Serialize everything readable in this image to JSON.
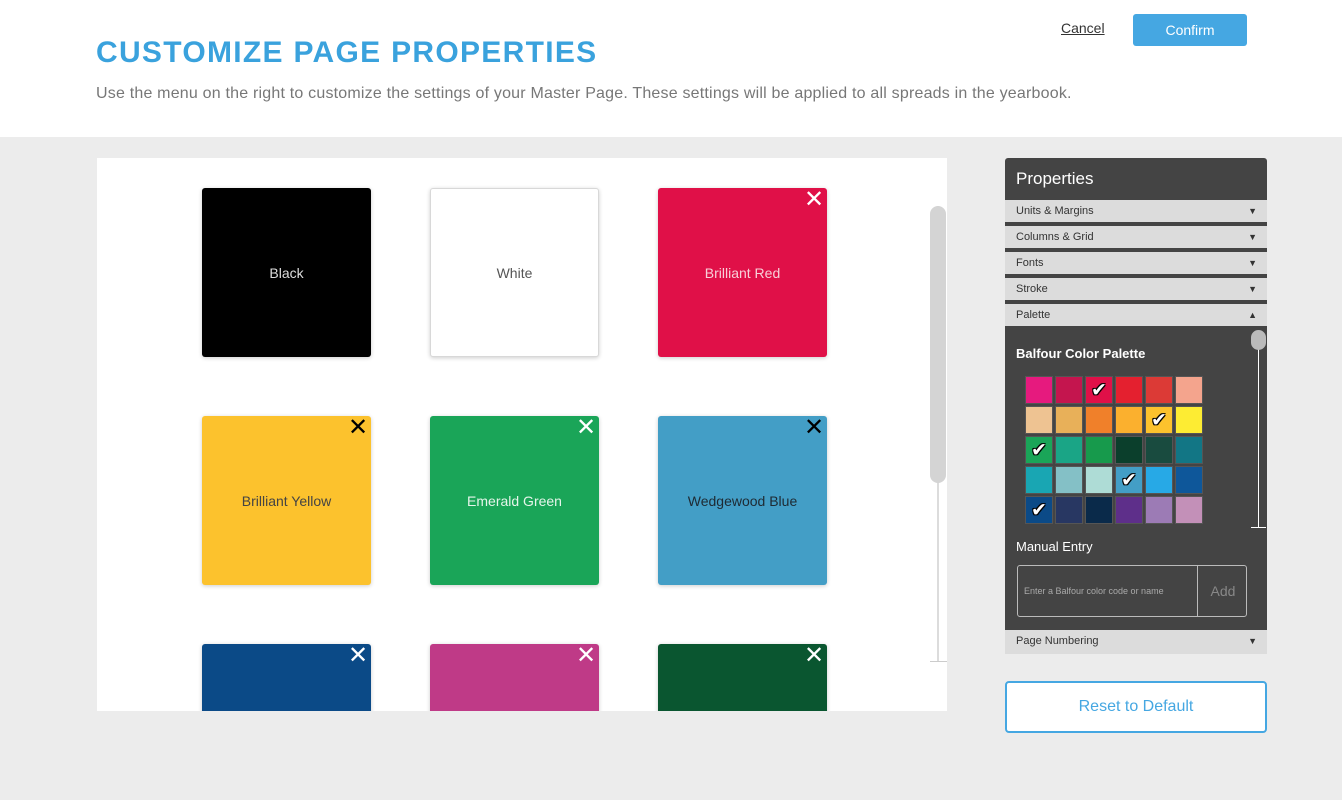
{
  "header": {
    "title": "CUSTOMIZE PAGE PROPERTIES",
    "subtitle": "Use the menu on the right to customize the settings of your Master Page. These settings will be applied to all spreads in the yearbook.",
    "cancel_label": "Cancel",
    "confirm_label": "Confirm"
  },
  "swatches": [
    {
      "label": "Black",
      "color": "#000000",
      "text_color": "#dddddd",
      "removable": false
    },
    {
      "label": "White",
      "color": "#ffffff",
      "text_color": "#555555",
      "removable": false
    },
    {
      "label": "Brilliant Red",
      "color": "#e01048",
      "text_color": "#f7d0d8",
      "removable": true,
      "x_color": "#ffffff"
    },
    {
      "label": "Brilliant Yellow",
      "color": "#fcc22d",
      "text_color": "#444444",
      "removable": true,
      "x_color": "#000000"
    },
    {
      "label": "Emerald Green",
      "color": "#1aa558",
      "text_color": "#e6f5ea",
      "removable": true,
      "x_color": "#ffffff"
    },
    {
      "label": "Wedgewood Blue",
      "color": "#439ec6",
      "text_color": "#1e2a33",
      "removable": true,
      "x_color": "#000000"
    },
    {
      "label": "",
      "color": "#0b4a87",
      "text_color": "#ffffff",
      "removable": true,
      "x_color": "#ffffff"
    },
    {
      "label": "",
      "color": "#bf3a87",
      "text_color": "#ffffff",
      "removable": true,
      "x_color": "#ffffff"
    },
    {
      "label": "",
      "color": "#0a5630",
      "text_color": "#ffffff",
      "removable": true,
      "x_color": "#ffffff"
    }
  ],
  "properties": {
    "title": "Properties",
    "sections": [
      {
        "label": "Units & Margins",
        "arrow": "▼"
      },
      {
        "label": "Columns & Grid",
        "arrow": "▼"
      },
      {
        "label": "Fonts",
        "arrow": "▼"
      },
      {
        "label": "Stroke",
        "arrow": "▼"
      },
      {
        "label": "Palette",
        "arrow": "▲"
      }
    ],
    "palette": {
      "heading": "Balfour Color Palette",
      "colors": [
        {
          "color": "#e61a7e",
          "checked": false
        },
        {
          "color": "#c4154e",
          "checked": false
        },
        {
          "color": "#e01048",
          "checked": true
        },
        {
          "color": "#e4202f",
          "checked": false
        },
        {
          "color": "#dc3a36",
          "checked": false
        },
        {
          "color": "#f4a48d",
          "checked": false
        },
        {
          "color": "#eec392",
          "checked": false
        },
        {
          "color": "#e8b059",
          "checked": false
        },
        {
          "color": "#f0802a",
          "checked": false
        },
        {
          "color": "#fbb02e",
          "checked": false
        },
        {
          "color": "#fcc22d",
          "checked": true
        },
        {
          "color": "#fdec33",
          "checked": false
        },
        {
          "color": "#1aa558",
          "checked": true
        },
        {
          "color": "#1aa586",
          "checked": false
        },
        {
          "color": "#179a4c",
          "checked": false
        },
        {
          "color": "#0b3f2c",
          "checked": false
        },
        {
          "color": "#194b3f",
          "checked": false
        },
        {
          "color": "#127685",
          "checked": false
        },
        {
          "color": "#19a6b3",
          "checked": false
        },
        {
          "color": "#84c0c6",
          "checked": false
        },
        {
          "color": "#aedcd6",
          "checked": false
        },
        {
          "color": "#439ec6",
          "checked": true
        },
        {
          "color": "#27a9e6",
          "checked": false
        },
        {
          "color": "#0e579a",
          "checked": false
        },
        {
          "color": "#0b4a87",
          "checked": true
        },
        {
          "color": "#283762",
          "checked": false
        },
        {
          "color": "#0a2a4a",
          "checked": false
        },
        {
          "color": "#5e2f8a",
          "checked": false
        },
        {
          "color": "#9c7bb5",
          "checked": false
        },
        {
          "color": "#c390b8",
          "checked": false
        }
      ],
      "manual_label": "Manual Entry",
      "manual_placeholder": "Enter a Balfour color code or name",
      "add_label": "Add"
    },
    "page_numbering": {
      "label": "Page Numbering",
      "arrow": "▼"
    }
  },
  "reset_label": "Reset to Default"
}
